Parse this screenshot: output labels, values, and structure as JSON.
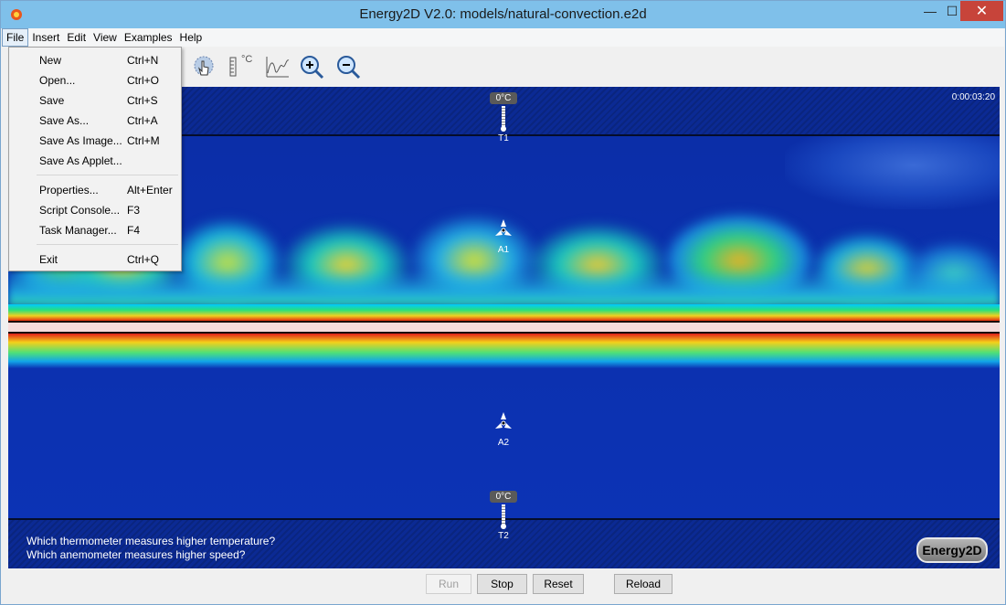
{
  "window": {
    "title": "Energy2D V2.0: models/natural-convection.e2d",
    "minimize": "—",
    "maximize": "☐",
    "close": "✕"
  },
  "menubar": [
    "File",
    "Insert",
    "Edit",
    "View",
    "Examples",
    "Help"
  ],
  "file_menu": [
    {
      "label": "New",
      "shortcut": "Ctrl+N"
    },
    {
      "label": "Open...",
      "shortcut": "Ctrl+O"
    },
    {
      "label": "Save",
      "shortcut": "Ctrl+S"
    },
    {
      "label": "Save As...",
      "shortcut": "Ctrl+A"
    },
    {
      "label": "Save As Image...",
      "shortcut": "Ctrl+M"
    },
    {
      "label": "Save As Applet...",
      "shortcut": ""
    },
    {
      "label": "Properties...",
      "shortcut": "Alt+Enter"
    },
    {
      "label": "Script Console...",
      "shortcut": "F3"
    },
    {
      "label": "Task Manager...",
      "shortcut": "F4"
    },
    {
      "label": "Exit",
      "shortcut": "Ctrl+Q"
    }
  ],
  "toolbar": {
    "icons": [
      "heatflux-icon",
      "thermometer-icon",
      "graph-icon",
      "zoom-in-icon",
      "zoom-out-icon"
    ],
    "degree_label": "°C"
  },
  "simulation": {
    "time": "0:00:03:20",
    "thermometer_t1": {
      "reading": "0°C",
      "label": "T1"
    },
    "thermometer_t2": {
      "reading": "0°C",
      "label": "T2"
    },
    "anemometer_a1": "A1",
    "anemometer_a2": "A2",
    "question_1": "Which thermometer measures higher temperature?",
    "question_2": "Which anemometer measures higher speed?",
    "brand": "Energy2D"
  },
  "controls": {
    "run": "Run",
    "stop": "Stop",
    "reset": "Reset",
    "reload": "Reload"
  },
  "colors": {
    "titlebar": "#7fc0ea",
    "field_blue": "#0c33b5",
    "hot_red": "#e02a10"
  }
}
